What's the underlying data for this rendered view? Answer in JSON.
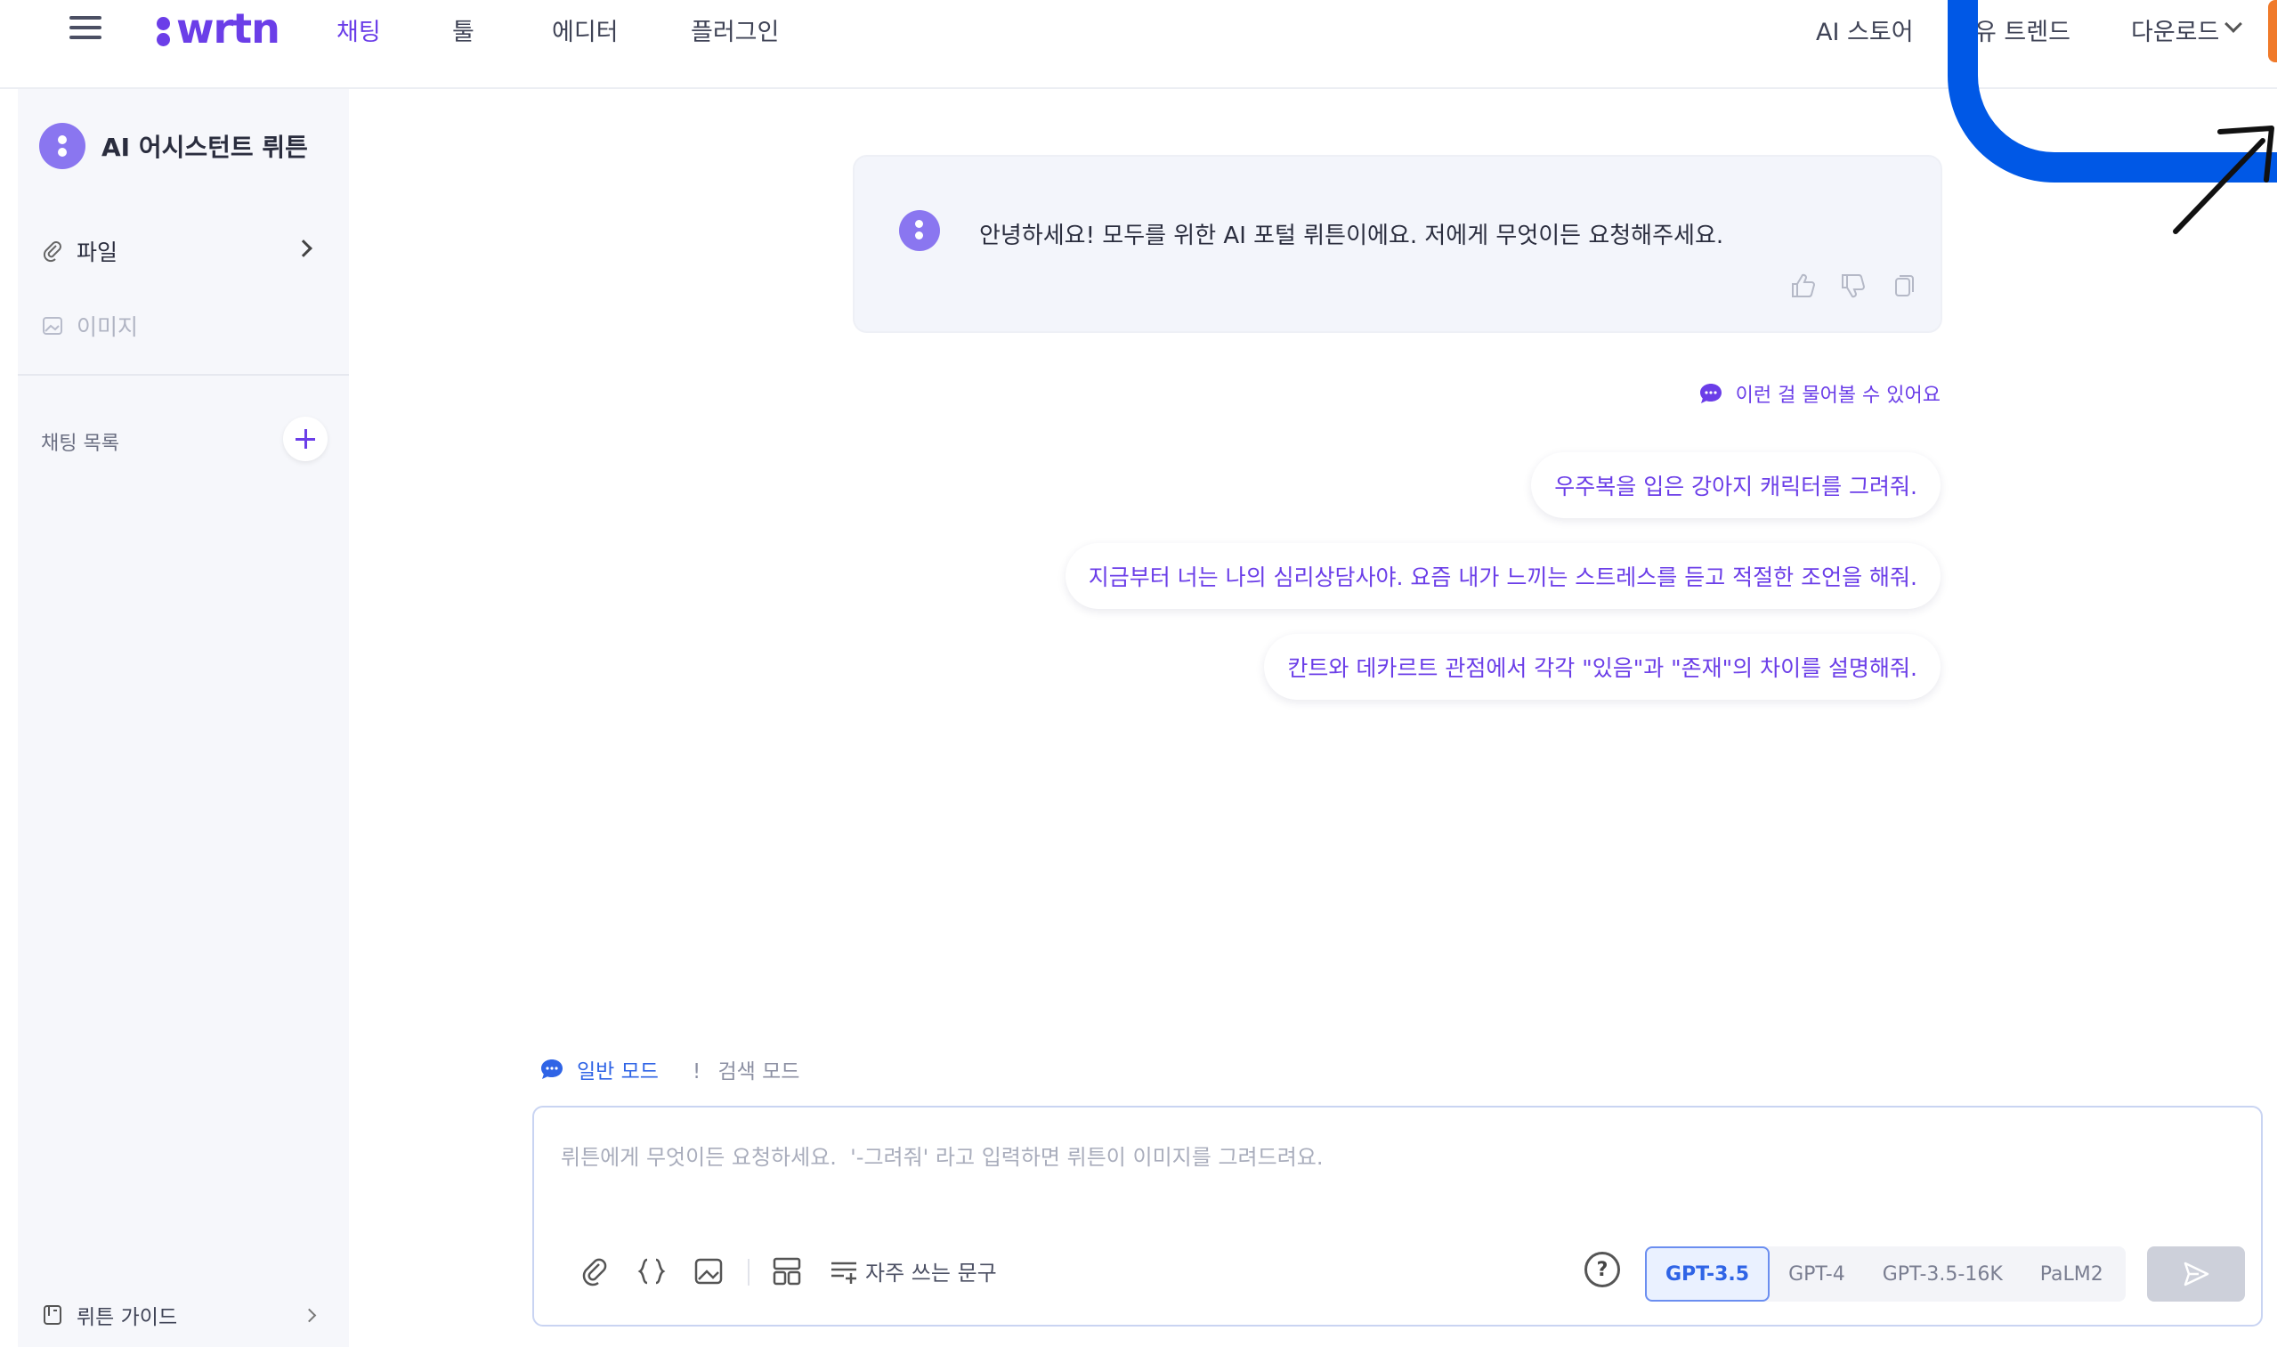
{
  "header": {
    "logo_text": "wrtn",
    "nav": [
      "채팅",
      "툴",
      "에디터",
      "플러그인"
    ],
    "right_nav": [
      "AI 스토어",
      "유 트렌드",
      "다운로드"
    ]
  },
  "sidebar": {
    "assistant_label": "AI 어시스턴트 뤼튼",
    "file_label": "파일",
    "image_label": "이미지",
    "chat_list_label": "채팅 목록",
    "guide_label": "뤼튼 가이드"
  },
  "chat": {
    "greeting": "안녕하세요! 모두를 위한 AI 포털 뤼튼이에요. 저에게 무엇이든 요청해주세요.",
    "suggest_header": "이런 걸 물어볼 수 있어요",
    "suggestions": [
      "우주복을 입은 강아지 캐릭터를 그려줘.",
      "지금부터 너는 나의 심리상담사야. 요즘 내가 느끼는 스트레스를 듣고 적절한 조언을 해줘.",
      "칸트와 데카르트 관점에서 각각 \"있음\"과 \"존재\"의 차이를 설명해줘."
    ]
  },
  "composer": {
    "mode_general": "일반 모드",
    "mode_search_mark": "!",
    "mode_search": "검색 모드",
    "placeholder": "뤼튼에게 무엇이든 요청하세요.  '-그려줘' 라고 입력하면 뤼튼이 이미지를 그려드려요.",
    "value": "",
    "phrases_label": "자주 쓰는 문구",
    "help_symbol": "?",
    "models": [
      "GPT-3.5",
      "GPT-4",
      "GPT-3.5-16K",
      "PaLM2"
    ],
    "selected_model": "GPT-3.5"
  },
  "colors": {
    "brand": "#6b3ee8",
    "selected_model": "#2f64e6",
    "annotation": "#0058e6"
  }
}
